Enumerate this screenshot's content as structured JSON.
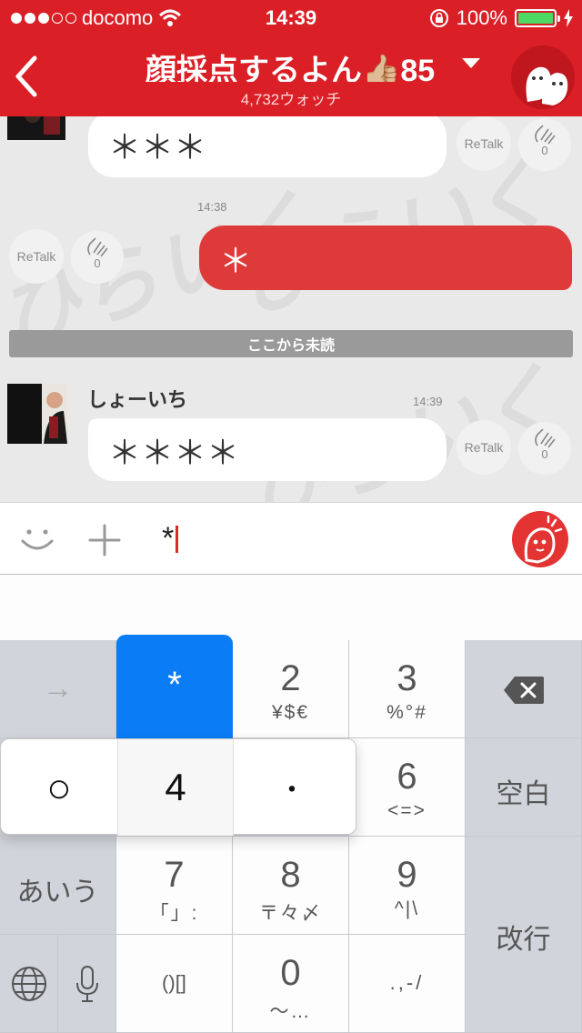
{
  "status_bar": {
    "carrier": "docomo",
    "time": "14:39",
    "battery": "100%",
    "signal_bars_filled": 3,
    "signal_bars_total": 5
  },
  "header": {
    "title": "顔採点するよん👍🏼85",
    "watchers": "4,732ウォッチ",
    "icons": [
      "back-chevron-icon",
      "dropdown-caret-icon",
      "ghost-avatar-icon"
    ]
  },
  "colors": {
    "brand_red": "#da1f26",
    "bubble_red": "#de3a3a",
    "keyboard_popup_blue": "#0a7cf5",
    "battery_green": "#4cd964"
  },
  "chat": {
    "watermark": "ひらいく",
    "messages": [
      {
        "side": "left",
        "text": "＊＊＊",
        "retalk": "ReTalk",
        "claps": "0"
      },
      {
        "side": "right",
        "time": "14:38",
        "text": "＊",
        "retalk": "ReTalk",
        "claps": "0"
      },
      {
        "side": "left",
        "user": "しょーいち",
        "time": "14:39",
        "text": "＊＊＊＊",
        "retalk": "ReTalk",
        "claps": "0"
      }
    ],
    "unread_divider": "ここから未読"
  },
  "input": {
    "value": "*",
    "icons": [
      "smiley-icon",
      "plus-icon",
      "send-mascot-icon"
    ]
  },
  "keyboard": {
    "popup_top": "*",
    "popup_options": [
      "○",
      "4",
      "・"
    ],
    "keys": {
      "arrow": "→",
      "k2": {
        "main": "2",
        "sub": "¥$€"
      },
      "k3": {
        "main": "3",
        "sub": "%°#"
      },
      "k6": {
        "main": "6",
        "sub": "<=>"
      },
      "space": "空白",
      "kana": "あいう",
      "k7": {
        "main": "7",
        "sub": "「」:"
      },
      "k8": {
        "main": "8",
        "sub": "〒々〆"
      },
      "k9": {
        "main": "9",
        "sub": "^|\\"
      },
      "return": "改行",
      "brackets": "()[]",
      "k0": {
        "main": "0",
        "sub": "〜…"
      },
      "punct": ".,-/"
    }
  }
}
